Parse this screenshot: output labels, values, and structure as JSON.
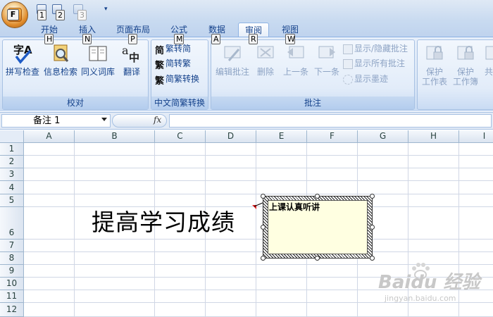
{
  "quick_access": {
    "office_button_letter": "F",
    "keytips": [
      "1",
      "2",
      "3"
    ]
  },
  "tabs": [
    {
      "label": "开始",
      "keytip": "H"
    },
    {
      "label": "插入",
      "keytip": "N"
    },
    {
      "label": "页面布局",
      "keytip": "P"
    },
    {
      "label": "公式",
      "keytip": "M"
    },
    {
      "label": "数据",
      "keytip": "A"
    },
    {
      "label": "审阅",
      "keytip": "R",
      "active": true
    },
    {
      "label": "视图",
      "keytip": "W"
    }
  ],
  "ribbon": {
    "proofing": {
      "label": "校对",
      "buttons": [
        "拼写检查",
        "信息检索",
        "同义词库",
        "翻译"
      ]
    },
    "chinese_conversion": {
      "label": "中文简繁转换",
      "buttons": [
        "繁转简",
        "简转繁",
        "简繁转换"
      ]
    },
    "comments": {
      "label": "批注",
      "big_buttons": [
        "编辑批注",
        "删除",
        "上一条",
        "下一条"
      ],
      "small_buttons": [
        "显示/隐藏批注",
        "显示所有批注",
        "显示墨迹"
      ]
    },
    "changes": {
      "buttons": [
        "保护\n工作表",
        "保护\n工作簿",
        "共"
      ]
    }
  },
  "formula_bar": {
    "name_box": "备注 1",
    "fx_label": "fx",
    "content": ""
  },
  "grid": {
    "columns": [
      "A",
      "B",
      "C",
      "D",
      "E",
      "F",
      "G",
      "H",
      "I"
    ],
    "rows": [
      "1",
      "2",
      "3",
      "4",
      "5",
      "6",
      "7",
      "8",
      "9",
      "10",
      "11",
      "12"
    ]
  },
  "cell_content": {
    "text": "提高学习成绩",
    "address": "B6"
  },
  "comment": {
    "text": "上课认真听讲"
  },
  "watermark": {
    "main": "Baidu 经验",
    "url": "jingyan.baidu.com"
  },
  "colors": {
    "ribbon_text": "#15428b",
    "comment_fill": "#ffffe1",
    "comment_indicator": "#e02020"
  }
}
